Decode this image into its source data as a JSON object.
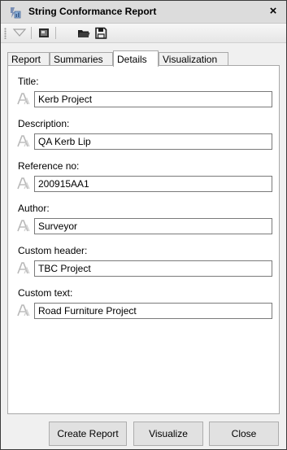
{
  "window": {
    "title": "String Conformance Report"
  },
  "tabs": [
    {
      "label": "Report"
    },
    {
      "label": "Summaries"
    },
    {
      "label": "Details"
    },
    {
      "label": "Visualization"
    }
  ],
  "active_tab": "Details",
  "fields": [
    {
      "label": "Title:",
      "value": "Kerb Project"
    },
    {
      "label": "Description:",
      "value": "QA Kerb Lip"
    },
    {
      "label": "Reference no:",
      "value": "200915AA1"
    },
    {
      "label": "Author:",
      "value": "Surveyor"
    },
    {
      "label": "Custom header:",
      "value": "TBC Project"
    },
    {
      "label": "Custom text:",
      "value": "Road Furniture Project"
    }
  ],
  "buttons": {
    "create_report": "Create Report",
    "visualize": "Visualize",
    "close": "Close"
  },
  "icons": {
    "app": "report-app-icon",
    "close": "close-icon",
    "toolbar": [
      "filter-icon",
      "display-icon",
      "folder-open-icon",
      "save-icon"
    ],
    "field": "text-style-icon"
  }
}
